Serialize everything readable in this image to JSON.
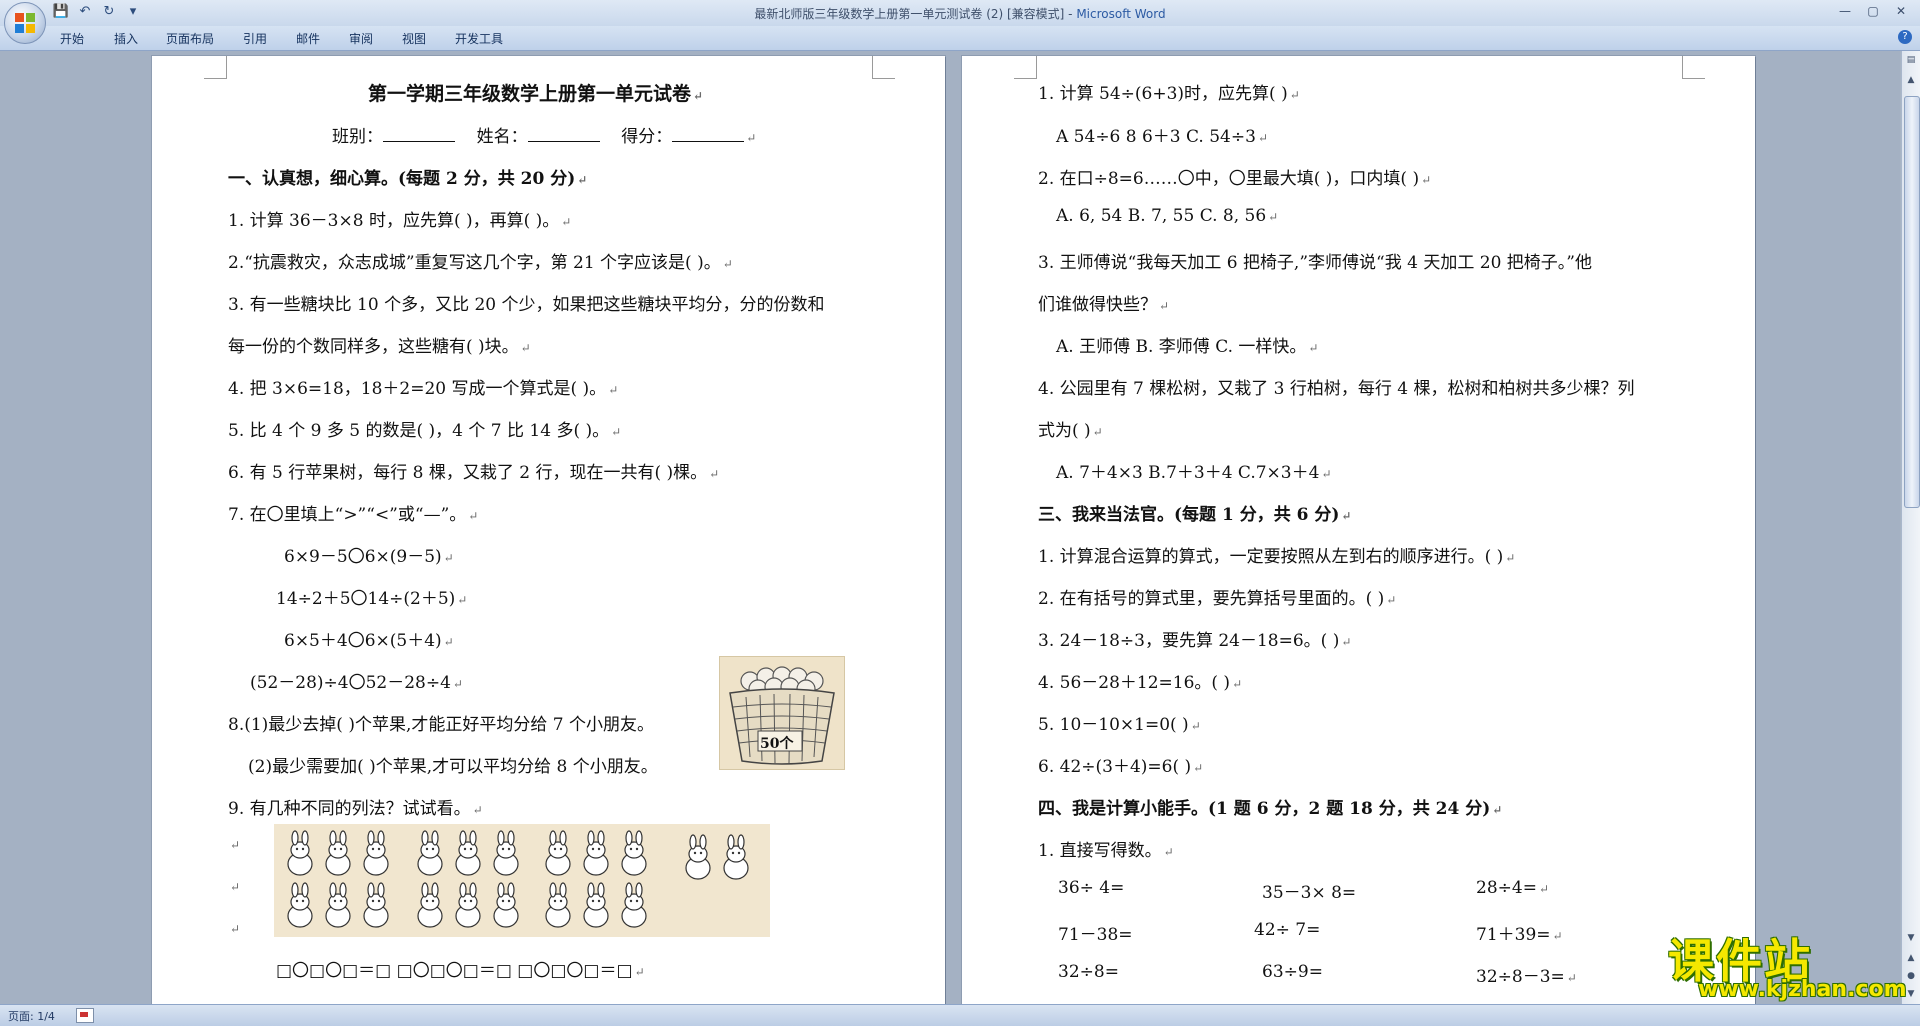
{
  "window": {
    "title_doc": "最新北师版三年级数学上册第一单元测试卷 (2) [兼容模式] - ",
    "title_app": "Microsoft Word"
  },
  "ribbon": {
    "tabs": [
      "开始",
      "插入",
      "页面布局",
      "引用",
      "邮件",
      "审阅",
      "视图",
      "开发工具"
    ]
  },
  "status": {
    "page": "页面: 1/4"
  },
  "left_page": {
    "title": "第一学期三年级数学上册第一单元试卷",
    "info": {
      "class_label": "班别：",
      "name_label": "姓名：",
      "score_label": "得分："
    },
    "section1": "一、认真想，细心算。(每题 2 分，共 20 分)",
    "lines": [
      "1. 计算 36－3×8 时，应先算(  )，再算(  )。",
      "2.“抗震救灾，众志成城”重复写这几个字，第 21 个字应该是(  )。",
      "3. 有一些糖块比 10 个多，又比 20 个少，如果把这些糖块平均分，分的份数和",
      "每一份的个数同样多，这些糖有(  )块。",
      "4. 把 3×6=18，18＋2=20 写成一个算式是(      )。",
      "5. 比 4 个 9 多 5 的数是(  )，4 个 7 比 14 多(  )。",
      "6. 有 5 行苹果树，每行 8 棵，又栽了 2 行，现在一共有(  )棵。",
      "7. 在〇里填上“>”“<”或“—”。",
      "6×9－5〇6×(9－5)",
      "14÷2＋5〇14÷(2＋5)",
      "6×5＋4〇6×(5＋4)",
      "(52－28)÷4〇52－28÷4",
      "8.(1)最少去掉(  )个苹果,才能正好平均分给 7 个小朋友。",
      "(2)最少需要加(  )个苹果,才可以平均分给 8 个小朋友。",
      "9. 有几种不同的列法？试试看。",
      "□〇□〇□＝□    □〇□〇□＝□      □〇□〇□＝□"
    ],
    "basket_label": "50个"
  },
  "right_page": {
    "lines": [
      "1. 计算 54÷(6+3)时，应先算(      )",
      "A  54÷6      8  6＋3      C. 54÷3",
      "2. 在口÷8=6……〇中，〇里最大填(  )，口内填(  )",
      "A. 6, 54      B. 7, 55      C. 8, 56",
      "3. 王师傅说“我每天加工 6 把椅子,”李师傅说“我 4 天加工 20 把椅子。”他",
      "们谁做得快些？",
      "A. 王师傅      B. 李师傅      C. 一样快。",
      "4. 公园里有 7 棵松树，又栽了 3 行柏树，每行 4 棵，松树和柏树共多少棵？列",
      "式为(  )",
      "A. 7＋4×3      B.7＋3＋4      C.7×3＋4"
    ],
    "section3": "三、我来当法官。(每题 1 分，共 6 分)",
    "judge": [
      "1. 计算混合运算的算式，一定要按照从左到右的顺序进行。(  )",
      "2. 在有括号的算式里，要先算括号里面的。(      )",
      "3. 24－18÷3，要先算 24－18=6。(  )",
      "4. 56－28＋12=16。(      )",
      "5. 10－10×1=0(      )",
      "6. 42÷(3＋4)=6(      )"
    ],
    "section4": "四、我是计算小能手。(1 题 6 分，2 题 18 分，共 24 分)",
    "sub1": "1. 直接写得数。",
    "grid": [
      [
        "36÷ 4=",
        "35－3× 8=",
        "28÷4="
      ],
      [
        "71－38=",
        "42÷ 7=",
        "71＋39="
      ],
      [
        "32÷8=",
        "63÷9=",
        "32÷8－3="
      ]
    ]
  },
  "watermark": {
    "cn": "课件站",
    "url": "www.kjzhan.com"
  }
}
